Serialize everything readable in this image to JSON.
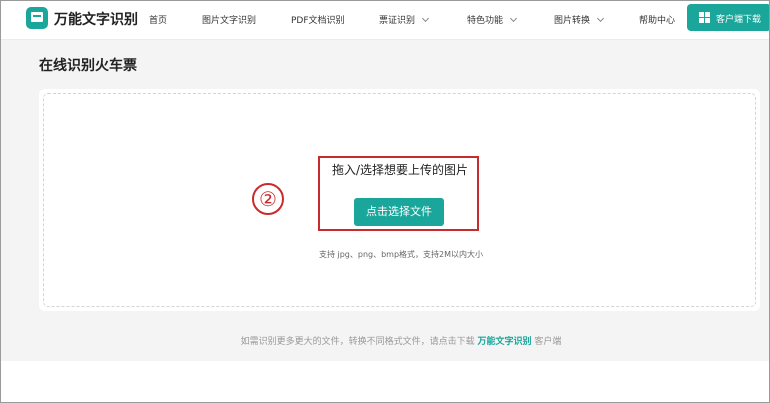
{
  "header": {
    "brand": "万能文字识别",
    "nav": [
      {
        "label": "首页",
        "dropdown": false
      },
      {
        "label": "图片文字识别",
        "dropdown": false
      },
      {
        "label": "PDF文档识别",
        "dropdown": false
      },
      {
        "label": "票证识别",
        "dropdown": true
      },
      {
        "label": "特色功能",
        "dropdown": true
      },
      {
        "label": "图片转换",
        "dropdown": true
      },
      {
        "label": "帮助中心",
        "dropdown": false
      }
    ],
    "download_label": "客户端下载"
  },
  "page": {
    "title": "在线识别火车票"
  },
  "upload": {
    "drop_text": "拖入/选择想要上传的图片",
    "choose_button": "点击选择文件",
    "formats": "支持 jpg、png、bmp格式，支持2M以内大小",
    "step_marker": "②"
  },
  "footer": {
    "note_prefix": "如需识别更多更大的文件，转换不同格式文件，请点击下载 ",
    "note_link": "万能文字识别",
    "note_suffix": " 客户端"
  },
  "colors": {
    "accent": "#1aa69b",
    "annotation_red": "#c82b2b"
  }
}
